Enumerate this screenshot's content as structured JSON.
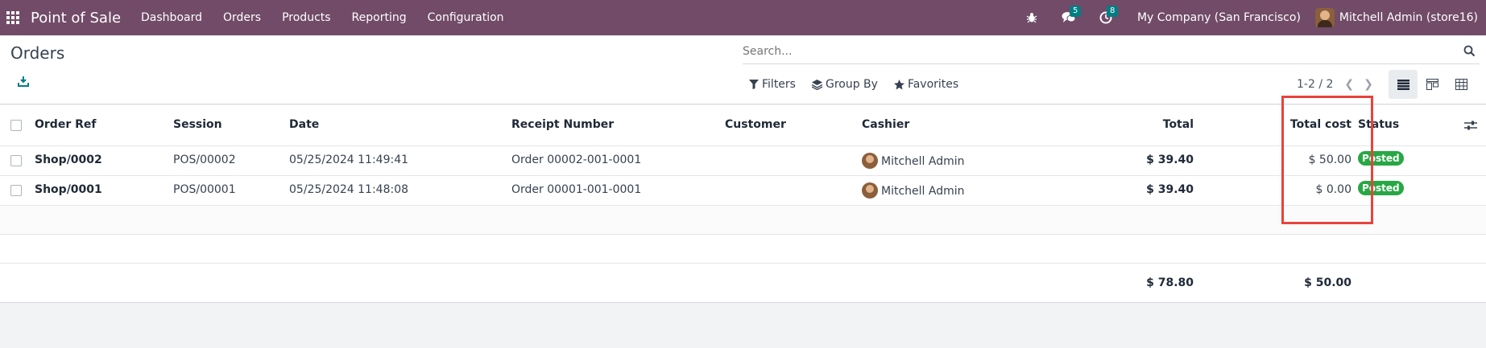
{
  "navbar": {
    "app_name": "Point of Sale",
    "menu": [
      "Dashboard",
      "Orders",
      "Products",
      "Reporting",
      "Configuration"
    ],
    "messages_count": "5",
    "activities_count": "8",
    "company": "My Company (San Francisco)",
    "user": "Mitchell Admin (store16)"
  },
  "control": {
    "title": "Orders",
    "search_placeholder": "Search...",
    "filters_label": "Filters",
    "groupby_label": "Group By",
    "favorites_label": "Favorites",
    "pager": "1-2 / 2"
  },
  "table": {
    "columns": [
      "Order Ref",
      "Session",
      "Date",
      "Receipt Number",
      "Customer",
      "Cashier",
      "Total",
      "Total cost",
      "Status"
    ],
    "rows": [
      {
        "order_ref": "Shop/0002",
        "session": "POS/00002",
        "date": "05/25/2024 11:49:41",
        "receipt": "Order 00002-001-0001",
        "customer": "",
        "cashier": "Mitchell Admin",
        "total": "$ 39.40",
        "total_cost": "$ 50.00",
        "status": "Posted"
      },
      {
        "order_ref": "Shop/0001",
        "session": "POS/00001",
        "date": "05/25/2024 11:48:08",
        "receipt": "Order 00001-001-0001",
        "customer": "",
        "cashier": "Mitchell Admin",
        "total": "$ 39.40",
        "total_cost": "$ 0.00",
        "status": "Posted"
      }
    ],
    "footer": {
      "total": "$ 78.80",
      "total_cost": "$ 50.00"
    }
  },
  "colors": {
    "navbar": "#714b67",
    "badge": "#017e84",
    "status_posted": "#28a745",
    "highlight": "#e8433b"
  }
}
